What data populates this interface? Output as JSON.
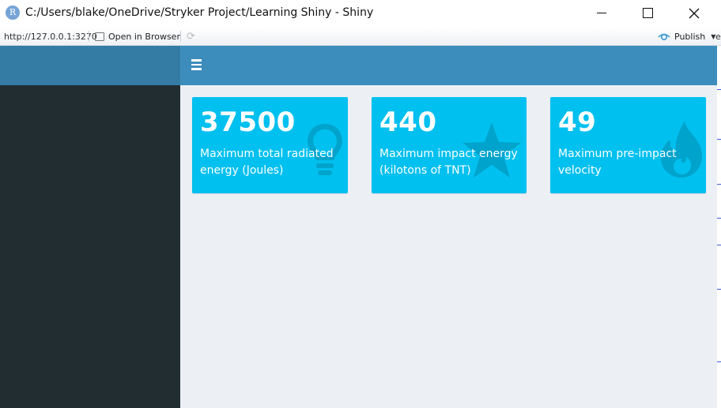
{
  "window": {
    "app_icon_letter": "R",
    "title": "C:/Users/blake/OneDrive/Stryker Project/Learning Shiny - Shiny"
  },
  "toolbar": {
    "url": "http://127.0.0.1:3270",
    "open_in_browser": "Open in Browser",
    "publish": "Publish",
    "edge_text": "e"
  },
  "dashboard": {
    "colors": {
      "navbar": "#3c8dbc",
      "logo": "#357ca5",
      "sidebar": "#222d32",
      "body": "#ecf0f5",
      "value_box": "#00c0ef"
    },
    "value_boxes": [
      {
        "value": "37500",
        "subtitle": "Maximum total radiated energy (Joules)",
        "icon": "lightbulb-icon"
      },
      {
        "value": "440",
        "subtitle": "Maximum impact energy (kilotons of TNT)",
        "icon": "star-icon"
      },
      {
        "value": "49",
        "subtitle": "Maximum pre-impact velocity",
        "icon": "fire-icon"
      }
    ]
  }
}
